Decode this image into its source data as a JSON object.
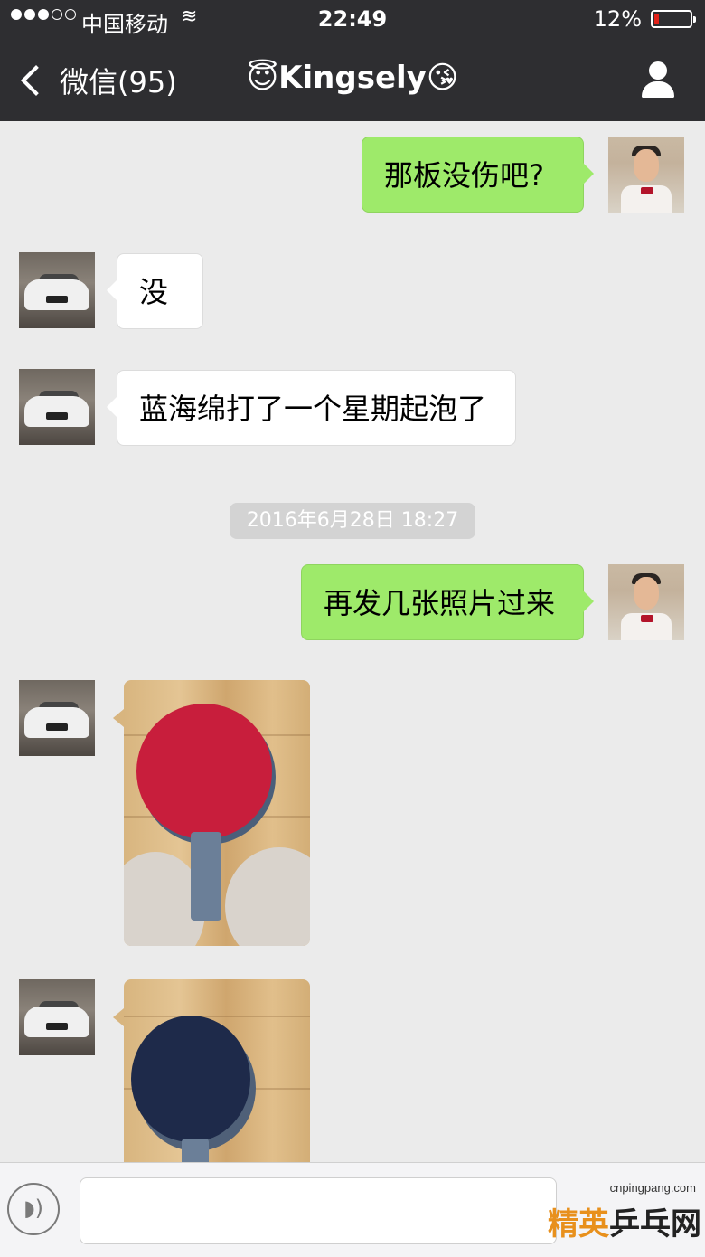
{
  "status_bar": {
    "carrier": "中国移动",
    "wifi_icon": "wifi-icon",
    "time": "22:49",
    "battery_percent": "12%",
    "battery_level": 0.12,
    "battery_color": "#e2231a"
  },
  "nav": {
    "back_label": "微信(95)",
    "title": "😇Kingsely😘",
    "profile_icon": "person-icon"
  },
  "messages": [
    {
      "direction": "out",
      "text": "那板没伤吧?"
    },
    {
      "direction": "in",
      "text": "没"
    },
    {
      "direction": "in",
      "text": "蓝海绵打了一个星期起泡了"
    },
    {
      "direction": "out",
      "text": "再发几张照片过来"
    },
    {
      "direction": "in",
      "type": "image",
      "description_icon": "photo-red-paddle"
    },
    {
      "direction": "in",
      "type": "image",
      "description_icon": "photo-blue-paddle"
    }
  ],
  "timestamp": "2016年6月28日 18:27",
  "input_bar": {
    "voice_icon": "voice-icon",
    "text_value": ""
  },
  "watermark": {
    "url": "cnpingpang.com",
    "logo_orange": "精英",
    "logo_dark": "乒乓网"
  },
  "colors": {
    "outgoing_bubble": "#9eea6a",
    "incoming_bubble": "#ffffff",
    "header": "#2e2e31",
    "background": "#ebebeb"
  }
}
